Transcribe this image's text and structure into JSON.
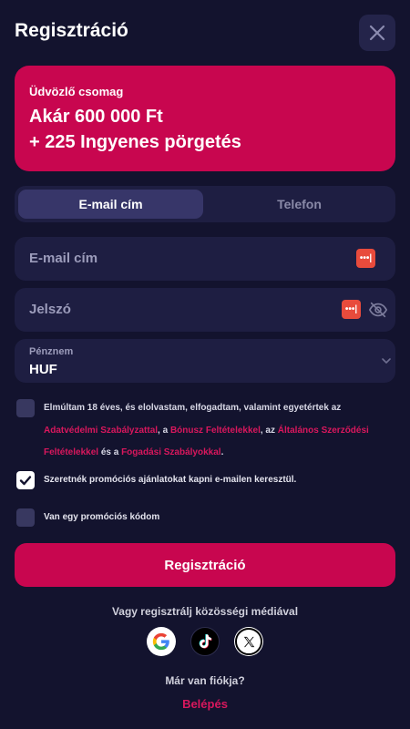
{
  "header": {
    "title": "Regisztráció",
    "close_icon": "close-icon"
  },
  "banner": {
    "label": "Üdvözlő csomag",
    "line1": "Akár 600 000 Ft",
    "line2": "+ 225 Ingyenes pörgetés",
    "color": "#c8064f"
  },
  "tabs": [
    {
      "label": "E-mail cím",
      "active": true
    },
    {
      "label": "Telefon",
      "active": false
    }
  ],
  "form": {
    "email": {
      "placeholder": "E-mail cím",
      "value": ""
    },
    "password": {
      "placeholder": "Jelszó",
      "value": "",
      "visibility_icon": "eye-slash-icon"
    },
    "password_manager_badge": "•••|",
    "currency": {
      "label": "Pénznem",
      "value": "HUF"
    }
  },
  "terms": {
    "checked": false,
    "text_before": "Elmúltam 18 éves, és elolvastam, elfogadtam, valamint egyetértek az",
    "link_privacy": "Adatvédelmi Szabályzattal",
    "sep1": ", a",
    "link_bonus": "Bónusz Feltételekkel",
    "sep2": ", az",
    "link_general": "Általános Szerződési Feltételekkel",
    "sep3": "és a",
    "link_betting": "Fogadási Szabályokkal",
    "end": "."
  },
  "promo_email": {
    "label": "Szeretnék promóciós ajánlatokat kapni e-mailen keresztül.",
    "checked": true
  },
  "promo_code": {
    "label": "Van egy promóciós kódom",
    "checked": false
  },
  "register_button": "Regisztráció",
  "social": {
    "prompt": "Vagy regisztrálj közösségi médiával",
    "providers": [
      "google-icon",
      "tiktok-icon",
      "x-icon"
    ]
  },
  "login": {
    "question": "Már van fiókja?",
    "link": "Belépés"
  },
  "colors": {
    "background": "#13132e",
    "accent": "#c8064f",
    "field": "#1e1e42"
  }
}
